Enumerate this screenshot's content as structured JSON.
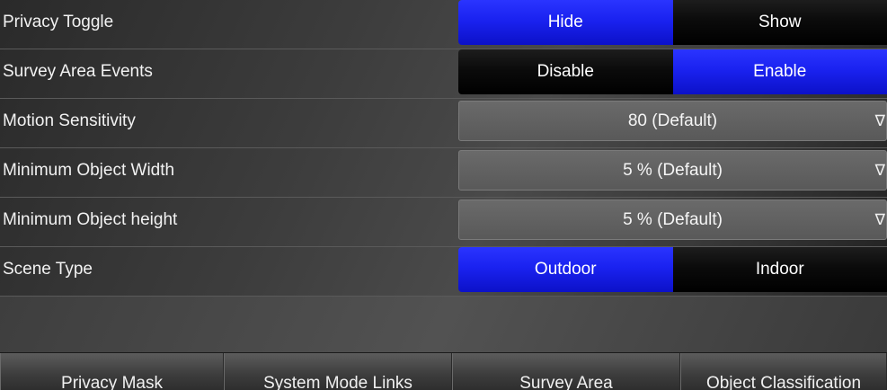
{
  "settings": {
    "privacy_toggle": {
      "label": "Privacy Toggle",
      "options": [
        "Hide",
        "Show"
      ],
      "selected": "Hide"
    },
    "survey_area_events": {
      "label": "Survey Area Events",
      "options": [
        "Disable",
        "Enable"
      ],
      "selected": "Enable"
    },
    "motion_sensitivity": {
      "label": "Motion Sensitivity",
      "value": "80 (Default)"
    },
    "min_object_width": {
      "label": "Minimum Object Width",
      "value": "5 % (Default)"
    },
    "min_object_height": {
      "label": "Minimum Object height",
      "value": "5 % (Default)"
    },
    "scene_type": {
      "label": "Scene Type",
      "options": [
        "Outdoor",
        "Indoor"
      ],
      "selected": "Outdoor"
    }
  },
  "dropdown_arrow": "∇",
  "tabs": [
    "Privacy Mask",
    "System Mode Links",
    "Survey Area",
    "Object Classification"
  ],
  "colors": {
    "active_segment": "#1a22f0",
    "inactive_segment": "#000000",
    "dropdown_bg": "#636363"
  }
}
